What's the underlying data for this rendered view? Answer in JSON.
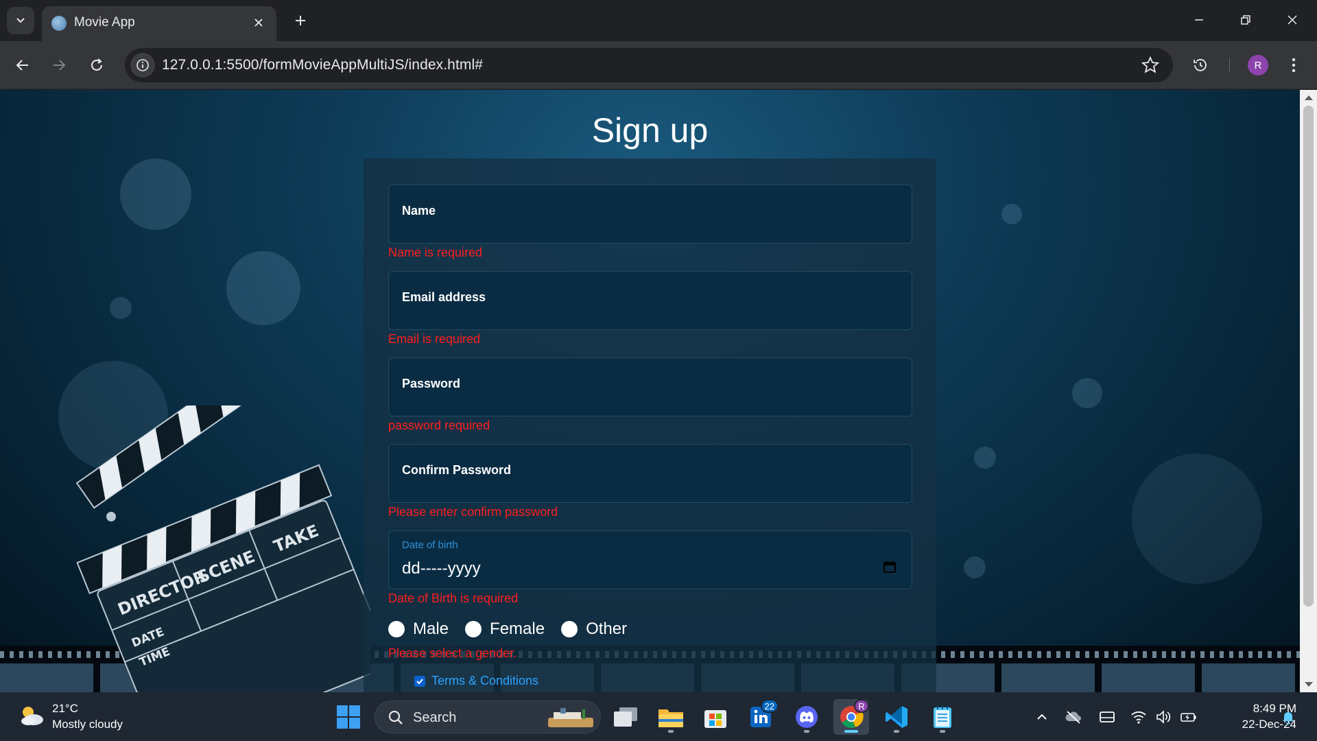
{
  "browser": {
    "tab_title": "Movie App",
    "url": "127.0.0.1:5500/formMovieAppMultiJS/index.html#",
    "profile_initial": "R"
  },
  "page": {
    "title": "Sign up",
    "fields": [
      {
        "label": "Name",
        "error": "Name is required"
      },
      {
        "label": "Email address",
        "error": "Email is required"
      },
      {
        "label": "Password",
        "error": "password required"
      },
      {
        "label": "Confirm Password",
        "error": "Please enter confirm password"
      }
    ],
    "dob": {
      "label": "Date of birth",
      "placeholder": "dd-----yyyy",
      "error": "Date of Birth is required"
    },
    "gender_options": [
      "Male",
      "Female",
      "Other"
    ],
    "gender_error": "Please select a gender.",
    "terms_label": "Terms & Conditions",
    "terms_checked": true
  },
  "clapperboard": {
    "labels": [
      "DIRECTOR",
      "SCENE",
      "TAKE",
      "DATE",
      "TIME"
    ]
  },
  "taskbar": {
    "weather_temp": "21°C",
    "weather_desc": "Mostly cloudy",
    "search_label": "Search",
    "linkedin_badge": "22",
    "chrome_badge": "R",
    "time": "8:49 PM",
    "date": "22-Dec-24"
  },
  "colors": {
    "error": "#ff1e1e",
    "accent_link": "#2aa3ff",
    "page_background": "#0e3b57"
  }
}
